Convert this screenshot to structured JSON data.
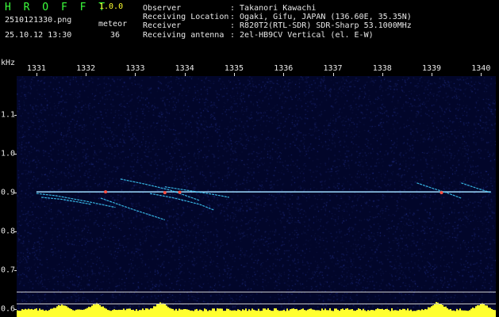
{
  "app": {
    "name": "H R O F F T",
    "version": "1.0.0",
    "filename": "2510121330.png",
    "mode": "meteor",
    "datetime": "25.10.12 13:30",
    "meteor_count": "36"
  },
  "info": [
    {
      "label": "Observer",
      "value": ": Takanori Kawachi"
    },
    {
      "label": "Receiving Location",
      "value": ": Ogaki, Gifu, JAPAN (136.60E, 35.35N)"
    },
    {
      "label": "Receiver",
      "value": ": R820T2(RTL-SDR) SDR-Sharp 53.1000MHz"
    },
    {
      "label": "Receiving antenna",
      "value": ": 2el-HB9CV Vertical (el. E-W)"
    }
  ],
  "colors": {
    "title": "#3cff3c",
    "text": "#e8e8e8",
    "accent": "#ffff30",
    "background": "#02062a",
    "carrier": "#9fdcff"
  },
  "chart_data": {
    "type": "heatmap",
    "xlabel": "",
    "ylabel": "kHz",
    "x_ticks": [
      "1331",
      "1332",
      "1333",
      "1334",
      "1335",
      "1336",
      "1337",
      "1338",
      "1339",
      "1340"
    ],
    "y_ticks": [
      "1.1",
      "1.0",
      "0.9",
      "0.8",
      "0.7",
      "0.6"
    ],
    "x_range": [
      1330.6,
      1340.3
    ],
    "y_range": [
      0.58,
      1.2
    ],
    "carrier": {
      "freq_khz": 0.902,
      "x_start": 1331.0,
      "x_end": 1340.2
    },
    "meteor_traces": [
      {
        "x": [
          1331.0,
          1331.4,
          1332.0,
          1332.6
        ],
        "y": [
          0.898,
          0.892,
          0.878,
          0.862
        ]
      },
      {
        "x": [
          1331.1,
          1331.5,
          1331.8,
          1332.1
        ],
        "y": [
          0.888,
          0.883,
          0.877,
          0.87
        ]
      },
      {
        "x": [
          1332.3,
          1332.7,
          1333.0,
          1333.6
        ],
        "y": [
          0.886,
          0.868,
          0.855,
          0.83
        ]
      },
      {
        "x": [
          1332.7,
          1333.2,
          1333.7,
          1334.3
        ],
        "y": [
          0.935,
          0.922,
          0.907,
          0.88
        ]
      },
      {
        "x": [
          1333.3,
          1333.8,
          1334.3,
          1334.6
        ],
        "y": [
          0.898,
          0.886,
          0.87,
          0.855
        ]
      },
      {
        "x": [
          1333.6,
          1334.1,
          1334.6,
          1334.9
        ],
        "y": [
          0.915,
          0.905,
          0.895,
          0.888
        ]
      },
      {
        "x": [
          1338.7,
          1339.0,
          1339.3,
          1339.6
        ],
        "y": [
          0.925,
          0.912,
          0.9,
          0.886
        ]
      },
      {
        "x": [
          1339.6,
          1339.9,
          1340.2
        ],
        "y": [
          0.925,
          0.912,
          0.9
        ]
      }
    ],
    "hot_spots": [
      {
        "x": 1332.4,
        "y": 0.902
      },
      {
        "x": 1333.6,
        "y": 0.9
      },
      {
        "x": 1333.9,
        "y": 0.901
      },
      {
        "x": 1339.2,
        "y": 0.9
      }
    ],
    "reference_lines_khz": [
      0.618,
      0.592
    ],
    "activity_bar": {
      "base_khz": 0.58,
      "peaks": [
        {
          "x": 1331.5,
          "level": 0.8
        },
        {
          "x": 1332.2,
          "level": 0.9
        },
        {
          "x": 1333.5,
          "level": 0.95
        },
        {
          "x": 1339.1,
          "level": 1.0
        },
        {
          "x": 1340.0,
          "level": 0.9
        }
      ]
    }
  }
}
